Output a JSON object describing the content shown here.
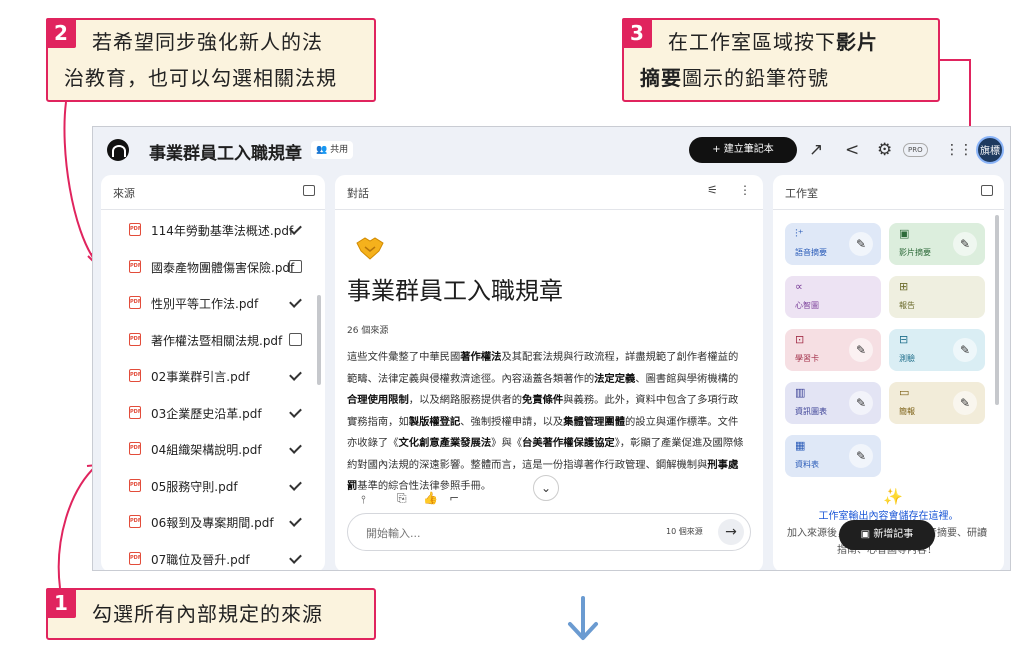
{
  "callouts": {
    "c1": {
      "num": "1",
      "text": "勾選所有內部規定的來源"
    },
    "c2": {
      "num": "2",
      "line1": "若希望同步強化新人的法",
      "line2": "治教育，也可以勾選相關法規"
    },
    "c3": {
      "num": "3",
      "line1_pre": "在工作室區域按下",
      "line1_bold": "影片",
      "line2_bold": "摘要",
      "line2_post": "圖示的鉛筆符號"
    }
  },
  "colors": {
    "callout_border": "#e0245e",
    "callout_bg": "#fbf3de",
    "arrow": "#6b9bd1"
  },
  "header": {
    "title": "事業群員工入職規章",
    "shared_label": "共用",
    "create_button": "+ 建立筆記本",
    "pro_badge": "PRO",
    "avatar_text": "旗標"
  },
  "sources": {
    "heading": "來源",
    "items": [
      {
        "label": "114年勞動基準法概述.pdf",
        "checked": true
      },
      {
        "label": "國泰產物團體傷害保險.pdf",
        "checked": false
      },
      {
        "label": "性別平等工作法.pdf",
        "checked": true
      },
      {
        "label": "著作權法暨相關法規.pdf",
        "checked": false
      },
      {
        "label": "02事業群引言.pdf",
        "checked": true
      },
      {
        "label": "03企業歷史沿革.pdf",
        "checked": true
      },
      {
        "label": "04組織架構說明.pdf",
        "checked": true
      },
      {
        "label": "05服務守則.pdf",
        "checked": true
      },
      {
        "label": "06報到及專案期間.pdf",
        "checked": true
      },
      {
        "label": "07職位及晉升.pdf",
        "checked": true
      }
    ]
  },
  "chat": {
    "heading": "對話",
    "notebook_title": "事業群員工入職規章",
    "source_count": "26 個來源",
    "summary": [
      {
        "t": "這些文件彙整了中華民國"
      },
      {
        "t": "著作權法",
        "b": true
      },
      {
        "t": "及其配套法規與行政流程，詳盡規範了創作者權益的範疇、法律定義與侵權救濟途徑。內容涵蓋各類著作的"
      },
      {
        "t": "法定定義",
        "b": true
      },
      {
        "t": "、圖書館與學術機構的"
      },
      {
        "t": "合理使用限制",
        "b": true
      },
      {
        "t": "，以及網路服務提供者的"
      },
      {
        "t": "免責條件",
        "b": true
      },
      {
        "t": "與義務。此外，資料中包含了多項行政實務指南，如"
      },
      {
        "t": "製版權登記",
        "b": true
      },
      {
        "t": "、強制授權申請，以及"
      },
      {
        "t": "集體管理團體",
        "b": true
      },
      {
        "t": "的設立與運作標準。文件亦收錄了《"
      },
      {
        "t": "文化創意產業發展法",
        "b": true
      },
      {
        "t": "》與《"
      },
      {
        "t": "台美著作權保護協定",
        "b": true
      },
      {
        "t": "》，彰顯了產業促進及國際條約對國內法規的深遠影響。整體而言，這是一份指導著作行政管理、鋼解機制與"
      },
      {
        "t": "刑事處罰",
        "b": true
      },
      {
        "t": "基準的綜合性法律參照手冊。"
      }
    ],
    "input_placeholder": "開始輸入...",
    "input_source_count": "10 個來源"
  },
  "studio": {
    "heading": "工作室",
    "tiles": [
      {
        "label": "語音摘要",
        "icon": "audio-wave-icon",
        "glyph": "⫶⁺",
        "bg": "#dfe8f7",
        "fg": "#2a5bb8",
        "pencil": true
      },
      {
        "label": "影片摘要",
        "icon": "video-icon",
        "glyph": "▣",
        "bg": "#dceedd",
        "fg": "#2e6b3a",
        "pencil": true
      },
      {
        "label": "心智圖",
        "icon": "mindmap-icon",
        "glyph": "∝",
        "bg": "#ede3f3",
        "fg": "#7a3d99",
        "pencil": false
      },
      {
        "label": "報告",
        "icon": "report-icon",
        "glyph": "⊞",
        "bg": "#efefe0",
        "fg": "#6a6a2a",
        "pencil": false
      },
      {
        "label": "學習卡",
        "icon": "flashcard-icon",
        "glyph": "⊡",
        "bg": "#f6dfe3",
        "fg": "#a3304a",
        "pencil": true
      },
      {
        "label": "測驗",
        "icon": "quiz-icon",
        "glyph": "⊟",
        "bg": "#daeef4",
        "fg": "#1f6f8b",
        "pencil": true
      },
      {
        "label": "資訊圖表",
        "icon": "infographic-icon",
        "glyph": "▥",
        "bg": "#e3e4f4",
        "fg": "#3a3f95",
        "pencil": true
      },
      {
        "label": "簡報",
        "icon": "slides-icon",
        "glyph": "▭",
        "bg": "#f2ecd9",
        "fg": "#7a5e12",
        "pencil": true
      },
      {
        "label": "資料表",
        "icon": "table-icon",
        "glyph": "▦",
        "bg": "#dfe8f7",
        "fg": "#2a5bb8",
        "pencil": true
      }
    ],
    "note_title": "工作室輸出內容會儲存在這裡。",
    "note_desc": "加入來源後，按一下即可新增語音摘要、研讀指南、心智圖等內容！",
    "add_note_button": "新增記事"
  }
}
